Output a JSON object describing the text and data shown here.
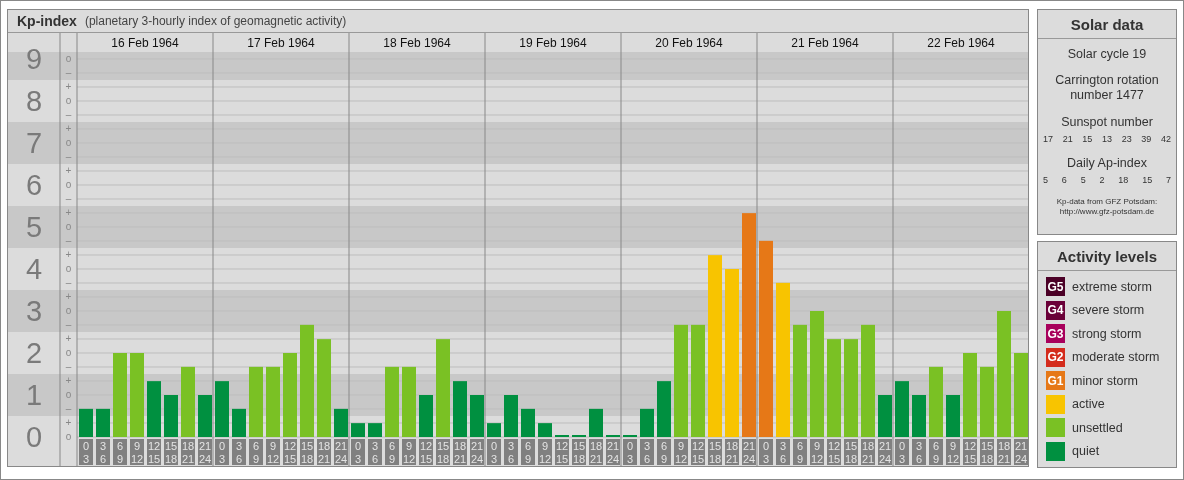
{
  "header": {
    "title": "Kp-index",
    "subtitle": "(planetary 3-hourly index of geomagnetic activity)"
  },
  "chart": {
    "days": [
      "16 Feb 1964",
      "17 Feb 1964",
      "18 Feb 1964",
      "19 Feb 1964",
      "20 Feb 1964",
      "21 Feb 1964",
      "22 Feb 1964"
    ],
    "scale_marks": [
      "o",
      "–",
      "+",
      "o",
      "–",
      "+",
      "o",
      "–",
      "+",
      "o",
      "–",
      "+",
      "o",
      "–",
      "+",
      "o",
      "–",
      "+",
      "o",
      "–",
      "+",
      "o",
      "–",
      "+",
      "o",
      "–",
      "+",
      "o"
    ],
    "chart_data": {
      "type": "bar",
      "ylim": [
        -0.7143,
        9.619
      ],
      "grid": true,
      "bands": [
        {
          "axis": "y",
          "from": 8.5,
          "to": 9.1667,
          "color": "#c8c8c8"
        },
        {
          "axis": "y",
          "from": 6.5,
          "to": 7.5,
          "color": "#c8c8c8"
        },
        {
          "axis": "y",
          "from": 4.5,
          "to": 5.5,
          "color": "#c8c8c8"
        },
        {
          "axis": "y",
          "from": 2.5,
          "to": 3.5,
          "color": "#c8c8c8"
        },
        {
          "axis": "y",
          "from": 0.5,
          "to": 1.5,
          "color": "#c8c8c8"
        }
      ],
      "yticks": [
        {
          "value": 9,
          "label": "9"
        },
        {
          "value": 8,
          "label": "8"
        },
        {
          "value": 7,
          "label": "7"
        },
        {
          "value": 6,
          "label": "6"
        },
        {
          "value": 5,
          "label": "5"
        },
        {
          "value": 4,
          "label": "4"
        },
        {
          "value": 3,
          "label": "3"
        },
        {
          "value": 2,
          "label": "2"
        },
        {
          "value": 1,
          "label": "1"
        },
        {
          "value": 0,
          "label": "0"
        }
      ],
      "categories": [
        "0 3",
        "3 6",
        "6 9",
        "9 12",
        "12 15",
        "15 18",
        "18 21",
        "21 24",
        "0 3",
        "3 6",
        "6 9",
        "9 12",
        "12 15",
        "15 18",
        "18 21",
        "21 24",
        "0 3",
        "3 6",
        "6 9",
        "9 12",
        "12 15",
        "15 18",
        "18 21",
        "21 24",
        "0 3",
        "3 6",
        "6 9",
        "9 12",
        "12 15",
        "15 18",
        "18 21",
        "21 24",
        "0 3",
        "3 6",
        "6 9",
        "9 12",
        "12 15",
        "15 18",
        "18 21",
        "21 24",
        "0 3",
        "3 6",
        "6 9",
        "9 12",
        "12 15",
        "15 18",
        "18 21",
        "21 24",
        "0 3",
        "3 6",
        "6 9",
        "9 12",
        "12 15",
        "15 18",
        "18 21",
        "21 24"
      ],
      "series": [
        {
          "color": "#009040",
          "values": [
            0.67,
            0.67,
            null,
            null,
            1.33,
            1,
            null,
            1,
            1.33,
            0.67,
            null,
            null,
            null,
            null,
            null,
            0.67,
            0.33,
            0.33,
            null,
            null,
            1,
            null,
            1.33,
            1,
            0.33,
            1,
            0.67,
            0.33,
            0,
            0,
            0.67,
            0,
            0,
            0.67,
            1.33,
            null,
            null,
            null,
            null,
            null,
            null,
            null,
            null,
            null,
            null,
            null,
            null,
            1,
            1.33,
            1,
            null,
            1,
            null,
            null,
            null,
            null
          ]
        },
        {
          "color": "#7ac124",
          "values": [
            null,
            null,
            2,
            2,
            null,
            null,
            1.67,
            null,
            null,
            null,
            1.67,
            1.67,
            2,
            2.67,
            2.33,
            null,
            null,
            null,
            1.67,
            1.67,
            null,
            2.33,
            null,
            null,
            null,
            null,
            null,
            null,
            null,
            null,
            null,
            null,
            null,
            null,
            null,
            2.67,
            2.67,
            null,
            null,
            null,
            null,
            null,
            2.67,
            3,
            2.33,
            2.33,
            2.67,
            null,
            null,
            null,
            1.67,
            null,
            2,
            1.67,
            3,
            2
          ]
        },
        {
          "color": "#f8c400",
          "values": [
            null,
            null,
            null,
            null,
            null,
            null,
            null,
            null,
            null,
            null,
            null,
            null,
            null,
            null,
            null,
            null,
            null,
            null,
            null,
            null,
            null,
            null,
            null,
            null,
            null,
            null,
            null,
            null,
            null,
            null,
            null,
            null,
            null,
            null,
            null,
            null,
            null,
            4.33,
            4,
            null,
            null,
            3.67,
            null,
            null,
            null,
            null,
            null,
            null,
            null,
            null,
            null,
            null,
            null,
            null,
            null,
            null
          ]
        },
        {
          "color": "#e67817",
          "values": [
            null,
            null,
            null,
            null,
            null,
            null,
            null,
            null,
            null,
            null,
            null,
            null,
            null,
            null,
            null,
            null,
            null,
            null,
            null,
            null,
            null,
            null,
            null,
            null,
            null,
            null,
            null,
            null,
            null,
            null,
            null,
            null,
            null,
            null,
            null,
            null,
            null,
            null,
            null,
            5.33,
            4.67,
            null,
            null,
            null,
            null,
            null,
            null,
            null,
            null,
            null,
            null,
            null,
            null,
            null,
            null,
            null
          ]
        }
      ]
    }
  },
  "solar_data": {
    "title": "Solar data",
    "cycle": "Solar cycle 19",
    "rotation": "Carrington rotation number 1477",
    "sunspot_label": "Sunspot number",
    "sunspots": [
      "17",
      "21",
      "15",
      "13",
      "23",
      "39",
      "42"
    ],
    "ap_label": "Daily Ap-index",
    "ap_values": [
      "5",
      "6",
      "5",
      "2",
      "18",
      "15",
      "7"
    ],
    "credit_lines": [
      "Kp-data from GFZ Potsdam:",
      "http://www.gfz-potsdam.de"
    ]
  },
  "activity_levels": {
    "title": "Activity levels",
    "items": [
      {
        "badge": "G5",
        "label": "extreme storm",
        "color": "#4b0026"
      },
      {
        "badge": "G4",
        "label": "severe storm",
        "color": "#6a0038"
      },
      {
        "badge": "G3",
        "label": "strong storm",
        "color": "#a8005c"
      },
      {
        "badge": "G2",
        "label": "moderate storm",
        "color": "#d42b1c"
      },
      {
        "badge": "G1",
        "label": "minor storm",
        "color": "#e67817"
      },
      {
        "label": "active",
        "color": "#f8c400"
      },
      {
        "label": "unsettled",
        "color": "#7ac124"
      },
      {
        "label": "quiet",
        "color": "#009040"
      }
    ]
  }
}
